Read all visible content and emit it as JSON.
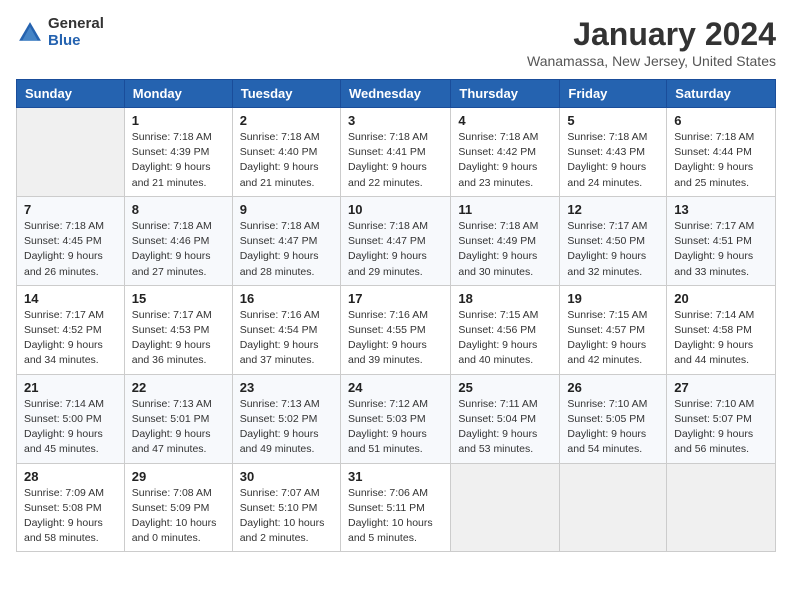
{
  "header": {
    "logo_general": "General",
    "logo_blue": "Blue",
    "month_title": "January 2024",
    "location": "Wanamassa, New Jersey, United States"
  },
  "weekdays": [
    "Sunday",
    "Monday",
    "Tuesday",
    "Wednesday",
    "Thursday",
    "Friday",
    "Saturday"
  ],
  "weeks": [
    [
      {
        "day": "",
        "info": ""
      },
      {
        "day": "1",
        "info": "Sunrise: 7:18 AM\nSunset: 4:39 PM\nDaylight: 9 hours\nand 21 minutes."
      },
      {
        "day": "2",
        "info": "Sunrise: 7:18 AM\nSunset: 4:40 PM\nDaylight: 9 hours\nand 21 minutes."
      },
      {
        "day": "3",
        "info": "Sunrise: 7:18 AM\nSunset: 4:41 PM\nDaylight: 9 hours\nand 22 minutes."
      },
      {
        "day": "4",
        "info": "Sunrise: 7:18 AM\nSunset: 4:42 PM\nDaylight: 9 hours\nand 23 minutes."
      },
      {
        "day": "5",
        "info": "Sunrise: 7:18 AM\nSunset: 4:43 PM\nDaylight: 9 hours\nand 24 minutes."
      },
      {
        "day": "6",
        "info": "Sunrise: 7:18 AM\nSunset: 4:44 PM\nDaylight: 9 hours\nand 25 minutes."
      }
    ],
    [
      {
        "day": "7",
        "info": "Sunrise: 7:18 AM\nSunset: 4:45 PM\nDaylight: 9 hours\nand 26 minutes."
      },
      {
        "day": "8",
        "info": "Sunrise: 7:18 AM\nSunset: 4:46 PM\nDaylight: 9 hours\nand 27 minutes."
      },
      {
        "day": "9",
        "info": "Sunrise: 7:18 AM\nSunset: 4:47 PM\nDaylight: 9 hours\nand 28 minutes."
      },
      {
        "day": "10",
        "info": "Sunrise: 7:18 AM\nSunset: 4:47 PM\nDaylight: 9 hours\nand 29 minutes."
      },
      {
        "day": "11",
        "info": "Sunrise: 7:18 AM\nSunset: 4:49 PM\nDaylight: 9 hours\nand 30 minutes."
      },
      {
        "day": "12",
        "info": "Sunrise: 7:17 AM\nSunset: 4:50 PM\nDaylight: 9 hours\nand 32 minutes."
      },
      {
        "day": "13",
        "info": "Sunrise: 7:17 AM\nSunset: 4:51 PM\nDaylight: 9 hours\nand 33 minutes."
      }
    ],
    [
      {
        "day": "14",
        "info": "Sunrise: 7:17 AM\nSunset: 4:52 PM\nDaylight: 9 hours\nand 34 minutes."
      },
      {
        "day": "15",
        "info": "Sunrise: 7:17 AM\nSunset: 4:53 PM\nDaylight: 9 hours\nand 36 minutes."
      },
      {
        "day": "16",
        "info": "Sunrise: 7:16 AM\nSunset: 4:54 PM\nDaylight: 9 hours\nand 37 minutes."
      },
      {
        "day": "17",
        "info": "Sunrise: 7:16 AM\nSunset: 4:55 PM\nDaylight: 9 hours\nand 39 minutes."
      },
      {
        "day": "18",
        "info": "Sunrise: 7:15 AM\nSunset: 4:56 PM\nDaylight: 9 hours\nand 40 minutes."
      },
      {
        "day": "19",
        "info": "Sunrise: 7:15 AM\nSunset: 4:57 PM\nDaylight: 9 hours\nand 42 minutes."
      },
      {
        "day": "20",
        "info": "Sunrise: 7:14 AM\nSunset: 4:58 PM\nDaylight: 9 hours\nand 44 minutes."
      }
    ],
    [
      {
        "day": "21",
        "info": "Sunrise: 7:14 AM\nSunset: 5:00 PM\nDaylight: 9 hours\nand 45 minutes."
      },
      {
        "day": "22",
        "info": "Sunrise: 7:13 AM\nSunset: 5:01 PM\nDaylight: 9 hours\nand 47 minutes."
      },
      {
        "day": "23",
        "info": "Sunrise: 7:13 AM\nSunset: 5:02 PM\nDaylight: 9 hours\nand 49 minutes."
      },
      {
        "day": "24",
        "info": "Sunrise: 7:12 AM\nSunset: 5:03 PM\nDaylight: 9 hours\nand 51 minutes."
      },
      {
        "day": "25",
        "info": "Sunrise: 7:11 AM\nSunset: 5:04 PM\nDaylight: 9 hours\nand 53 minutes."
      },
      {
        "day": "26",
        "info": "Sunrise: 7:10 AM\nSunset: 5:05 PM\nDaylight: 9 hours\nand 54 minutes."
      },
      {
        "day": "27",
        "info": "Sunrise: 7:10 AM\nSunset: 5:07 PM\nDaylight: 9 hours\nand 56 minutes."
      }
    ],
    [
      {
        "day": "28",
        "info": "Sunrise: 7:09 AM\nSunset: 5:08 PM\nDaylight: 9 hours\nand 58 minutes."
      },
      {
        "day": "29",
        "info": "Sunrise: 7:08 AM\nSunset: 5:09 PM\nDaylight: 10 hours\nand 0 minutes."
      },
      {
        "day": "30",
        "info": "Sunrise: 7:07 AM\nSunset: 5:10 PM\nDaylight: 10 hours\nand 2 minutes."
      },
      {
        "day": "31",
        "info": "Sunrise: 7:06 AM\nSunset: 5:11 PM\nDaylight: 10 hours\nand 5 minutes."
      },
      {
        "day": "",
        "info": ""
      },
      {
        "day": "",
        "info": ""
      },
      {
        "day": "",
        "info": ""
      }
    ]
  ]
}
